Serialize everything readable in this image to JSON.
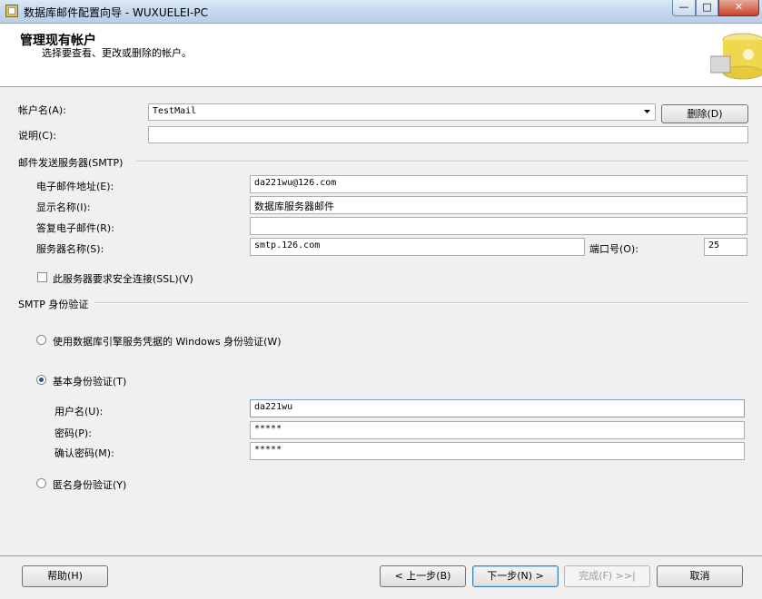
{
  "window": {
    "title": "数据库邮件配置向导 - WUXUELEI-PC",
    "minimize": "—",
    "maximize": "□",
    "close": "✕"
  },
  "header": {
    "title": "管理现有帐户",
    "subtitle": "选择要查看、更改或删除的帐户。"
  },
  "account": {
    "name_label": "帐户名(A):",
    "name_value": "TestMail",
    "delete_label": "删除(D)",
    "desc_label": "说明(C):",
    "desc_value": ""
  },
  "smtp": {
    "section_label": "邮件发送服务器(SMTP)",
    "email_label": "电子邮件地址(E):",
    "email_value": "da221wu@126.com",
    "display_label": "显示名称(I):",
    "display_value": "数据库服务器邮件",
    "reply_label": "答复电子邮件(R):",
    "reply_value": "",
    "server_label": "服务器名称(S):",
    "server_value": "smtp.126.com",
    "port_label": "端口号(O):",
    "port_value": "25",
    "ssl_label": "此服务器要求安全连接(SSL)(V)",
    "ssl_checked": false
  },
  "auth": {
    "section_label": "SMTP 身份验证",
    "windows_label": "使用数据库引擎服务凭据的 Windows 身份验证(W)",
    "basic_label": "基本身份验证(T)",
    "selected": "basic",
    "username_label": "用户名(U):",
    "username_value": "da221wu",
    "password_label": "密码(P):",
    "password_value": "*****",
    "confirm_label": "确认密码(M):",
    "confirm_value": "*****",
    "anonymous_label": "匿名身份验证(Y)"
  },
  "footer": {
    "help": "帮助(H)",
    "back": "< 上一步(B)",
    "next": "下一步(N) >",
    "finish": "完成(F) >>|",
    "cancel": "取消"
  },
  "icons": [
    "app-icon",
    "dropdown-arrow-icon",
    "wizard-header-graphic"
  ],
  "colors": {
    "accent": "#2d4e8f",
    "header_bg": "#ffffff",
    "body_bg": "#f0f0f0"
  }
}
